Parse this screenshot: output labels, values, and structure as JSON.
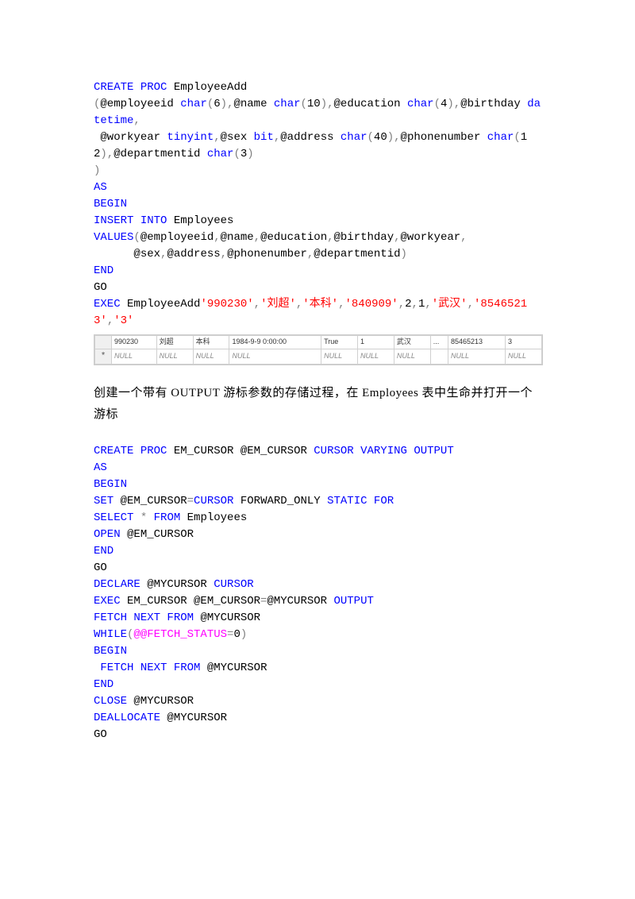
{
  "block1": {
    "l1a": "CREATE",
    "l1b": " PROC",
    "l1c": " EmployeeAdd",
    "l2a": "(",
    "l2b": "@employeeid ",
    "l2c": "char",
    "l2d": "(",
    "l2e": "6",
    "l2f": "),",
    "l2g": "@name ",
    "l2h": "char",
    "l2i": "(",
    "l2j": "10",
    "l2k": "),",
    "l2l": "@education ",
    "l2m": "char",
    "l2n": "(",
    "l2o": "4",
    "l2p": "),",
    "l2q": "@birthday ",
    "l2r": "datetime",
    "l2s": ",",
    "l3a": " @workyear ",
    "l3b": "tinyint",
    "l3c": ",",
    "l3d": "@sex ",
    "l3e": "bit",
    "l3f": ",",
    "l3g": "@address ",
    "l3h": "char",
    "l3i": "(",
    "l3j": "40",
    "l3k": "),",
    "l3l": "@phonenumber ",
    "l3m": "char",
    "l3n": "(",
    "l3o": "12",
    "l3p": "),",
    "l3q": "@departmentid ",
    "l3r": "char",
    "l3s": "(",
    "l3t": "3",
    "l3u": ")",
    "l4a": ")",
    "l5a": "AS",
    "l6a": "BEGIN",
    "l7a": "INSERT",
    "l7b": " INTO",
    "l7c": " Employees",
    "l8a": "VALUES",
    "l8b": "(",
    "l8c": "@employeeid",
    "l8d": ",",
    "l8e": "@name",
    "l8f": ",",
    "l8g": "@education",
    "l8h": ",",
    "l8i": "@birthday",
    "l8j": ",",
    "l8k": "@workyear",
    "l8l": ",",
    "l9a": "      @sex",
    "l9b": ",",
    "l9c": "@address",
    "l9d": ",",
    "l9e": "@phonenumber",
    "l9f": ",",
    "l9g": "@departmentid",
    "l9h": ")",
    "l10a": "END",
    "l11a": "GO",
    "l12a": "EXEC",
    "l12b": " EmployeeAdd",
    "l12c": "'990230'",
    "l12d": ",",
    "l12e": "'刘超'",
    "l12f": ",",
    "l12g": "'本科'",
    "l12h": ",",
    "l12i": "'840909'",
    "l12j": ",",
    "l12k": "2",
    "l12l": ",",
    "l12m": "1",
    "l12n": ",",
    "l12o": "'武汉'",
    "l12p": ",",
    "l12q": "'85465213'",
    "l12r": ",",
    "l12s": "'3'"
  },
  "table": {
    "row1": {
      "c1": "990230",
      "c2": "刘超",
      "c3": "本科",
      "c4": "1984-9-9 0:00:00",
      "c5": "True",
      "c6": "1",
      "c7": "武汉",
      "c8": "...",
      "c9": "85465213",
      "c10": "3"
    },
    "row2": {
      "star": "*",
      "null": "NULL"
    }
  },
  "heading": "创建一个带有 OUTPUT 游标参数的存储过程，在 Employees 表中生命并打开一个游标",
  "block2": {
    "l1a": "CREATE",
    "l1b": " PROC",
    "l1c": " EM_CURSOR @EM_CURSOR ",
    "l1d": "CURSOR",
    "l1e": " VARYING",
    "l1f": " OUTPUT",
    "l2a": "AS",
    "l3a": "BEGIN",
    "l4a": "SET",
    "l4b": " @EM_CURSOR",
    "l4c": "=",
    "l4d": "CURSOR",
    "l4e": " FORWARD_ONLY ",
    "l4f": "STATIC",
    "l4g": " FOR",
    "l5a": "SELECT",
    "l5b": " *",
    "l5c": " FROM",
    "l5d": " Employees",
    "l6a": "OPEN",
    "l6b": " @EM_CURSOR",
    "l7a": "END",
    "l8a": "GO",
    "l9a": "DECLARE",
    "l9b": " @MYCURSOR ",
    "l9c": "CURSOR",
    "l10a": "EXEC",
    "l10b": " EM_CURSOR @EM_CURSOR",
    "l10c": "=",
    "l10d": "@MYCURSOR ",
    "l10e": "OUTPUT",
    "l11a": "FETCH",
    "l11b": " NEXT",
    "l11c": " FROM",
    "l11d": " @MYCURSOR",
    "l12a": "WHILE",
    "l12b": "(",
    "l12c": "@@FETCH_STATUS",
    "l12d": "=",
    "l12e": "0",
    "l12f": ")",
    "l13a": "BEGIN",
    "l14a": " FETCH",
    "l14b": " NEXT",
    "l14c": " FROM",
    "l14d": " @MYCURSOR",
    "l15a": "END",
    "l16a": "CLOSE",
    "l16b": " @MYCURSOR",
    "l17a": "DEALLOCATE",
    "l17b": " @MYCURSOR",
    "l18a": "GO"
  }
}
